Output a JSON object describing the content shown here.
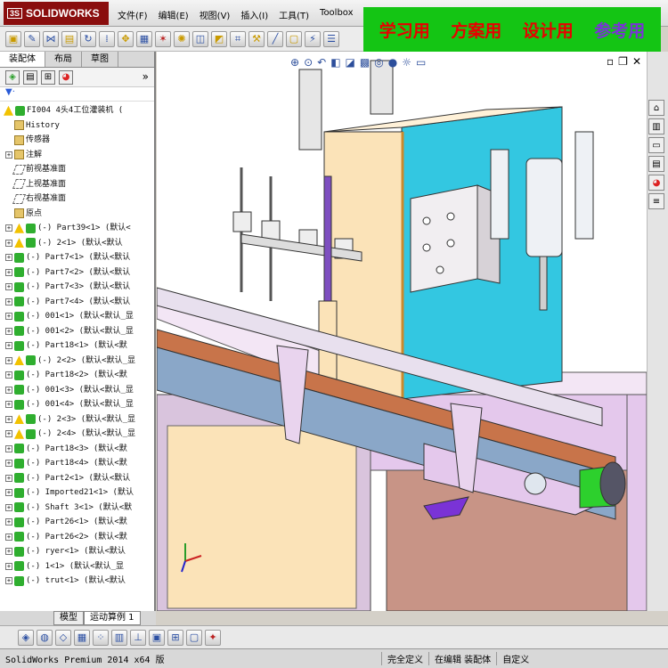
{
  "window": {
    "logo_text": "SOLIDWORKS",
    "logo_mark": "3S",
    "menus": [
      "文件(F)",
      "编辑(E)",
      "视图(V)",
      "插入(I)",
      "工具(T)",
      "Toolbox"
    ]
  },
  "banner": {
    "items": [
      "学习用",
      "方案用",
      "设计用",
      "参考用"
    ],
    "colors": [
      "#e80000",
      "#e80000",
      "#e80000",
      "#7a33d6"
    ]
  },
  "panel": {
    "tabs": [
      "装配体",
      "布局",
      "草图"
    ],
    "root": "FI004 4头4工位灌装机 (",
    "fixed_items": [
      {
        "label": "History",
        "icon": "history-icon"
      },
      {
        "label": "传感器",
        "icon": "sensor-icon"
      },
      {
        "label": "注解",
        "icon": "annotation-icon"
      },
      {
        "label": "前视基准面",
        "icon": "plane-icon"
      },
      {
        "label": "上视基准面",
        "icon": "plane-icon"
      },
      {
        "label": "右视基准面",
        "icon": "plane-icon"
      },
      {
        "label": "原点",
        "icon": "origin-icon"
      }
    ],
    "components": [
      {
        "label": "(-) Part39<1> (默认<",
        "warn": true
      },
      {
        "label": "(-) 2<1> (默认<默认",
        "warn": true
      },
      {
        "label": "(-) Part7<1> (默认<默认",
        "warn": false
      },
      {
        "label": "(-) Part7<2> (默认<默认",
        "warn": false
      },
      {
        "label": "(-) Part7<3> (默认<默认",
        "warn": false
      },
      {
        "label": "(-) Part7<4> (默认<默认",
        "warn": false
      },
      {
        "label": "(-) 001<1> (默认<默认_显",
        "warn": false
      },
      {
        "label": "(-) 001<2> (默认<默认_显",
        "warn": false
      },
      {
        "label": "(-) Part18<1> (默认<默",
        "warn": false
      },
      {
        "label": "(-) 2<2> (默认<默认_显",
        "warn": true
      },
      {
        "label": "(-) Part18<2> (默认<默",
        "warn": false
      },
      {
        "label": "(-) 001<3> (默认<默认_显",
        "warn": false
      },
      {
        "label": "(-) 001<4> (默认<默认_显",
        "warn": false
      },
      {
        "label": "(-) 2<3> (默认<默认_显",
        "warn": true
      },
      {
        "label": "(-) 2<4> (默认<默认_显",
        "warn": true
      },
      {
        "label": "(-) Part18<3> (默认<默",
        "warn": false
      },
      {
        "label": "(-) Part18<4> (默认<默",
        "warn": false
      },
      {
        "label": "(-) Part2<1> (默认<默认",
        "warn": false
      },
      {
        "label": "(-) Imported21<1> (默认",
        "warn": false
      },
      {
        "label": "(-) Shaft 3<1> (默认<默",
        "warn": false
      },
      {
        "label": "(-) Part26<1> (默认<默",
        "warn": false
      },
      {
        "label": "(-) Part26<2> (默认<默",
        "warn": false
      },
      {
        "label": "(-) ryer<1> (默认<默认",
        "warn": false
      },
      {
        "label": "(-) 1<1> (默认<默认_显",
        "warn": false
      },
      {
        "label": "(-) trut<1> (默认<默认",
        "warn": false
      }
    ]
  },
  "bottom_tabs": [
    "模型",
    "运动算例 1"
  ],
  "status": {
    "app": "SolidWorks Premium 2014 x64 版",
    "cells": [
      "完全定义",
      "在编辑 装配体",
      "自定义"
    ]
  },
  "colors": {
    "cabinet_cyan": "#33c7e1",
    "panel_beige": "#fbe3b8",
    "frame_lavender": "#e4c8ec",
    "conveyor_blue": "#8aa7c8",
    "chain_copper": "#c8744a",
    "motor_green": "#2dd02d",
    "brown_panel": "#c89486"
  }
}
